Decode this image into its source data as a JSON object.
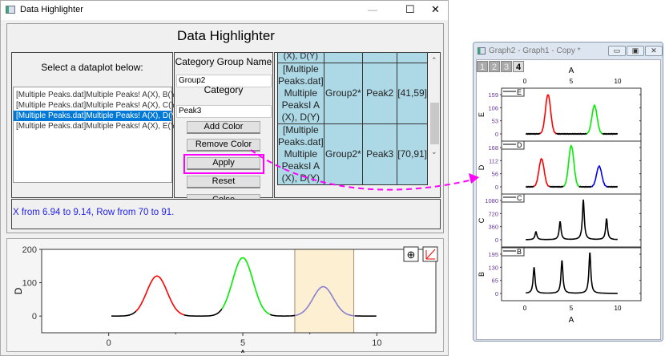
{
  "window": {
    "title": "Data Highlighter",
    "minimize": "—",
    "maximize": "☐",
    "close": "✕"
  },
  "dialog": {
    "heading": "Data Highlighter",
    "left": {
      "prompt": "Select a dataplot below:",
      "items": [
        {
          "label": "[Multiple Peaks.dat]Multiple Peaks! A(X), B(Y)",
          "selected": false
        },
        {
          "label": "[Multiple Peaks.dat]Multiple Peaks! A(X), C(Y)",
          "selected": false
        },
        {
          "label": "[Multiple Peaks.dat]Multiple Peaks! A(X), D(Y)",
          "selected": true
        },
        {
          "label": "[Multiple Peaks.dat]Multiple Peaks! A(X), E(Y)",
          "selected": false
        }
      ]
    },
    "middle": {
      "group_label": "Category Group Name",
      "group_value": "Group2",
      "category_label": "Category",
      "category_value": "Peak3",
      "buttons": {
        "add": "Add Color",
        "remove": "Remove Color",
        "apply": "Apply",
        "reset": "Reset",
        "close": "Colse"
      }
    },
    "table": {
      "partial_row": "(X), D(Y)",
      "rows": [
        {
          "plot": "[Multiple Peaks.dat] Multiple PeaksI A (X), D(Y)",
          "group": "Group2*",
          "category": "Peak2",
          "range": "[41,59]"
        },
        {
          "plot": "[Multiple Peaks.dat] Multiple PeaksI A (X), D(Y)",
          "group": "Group2*",
          "category": "Peak3",
          "range": "[70,91]"
        }
      ]
    },
    "status": "X from 6.94 to 9.14, Row from 70 to 91.",
    "highlight_color": "#ff00ff"
  },
  "chart_data": [
    {
      "type": "line",
      "id": "main",
      "xlabel": "A",
      "ylabel": "D",
      "xlim": [
        -2.5,
        12.2
      ],
      "ylim": [
        -50,
        200
      ],
      "xticks": [
        "0",
        "5",
        "10"
      ],
      "yticks": [
        "0",
        "100",
        "200"
      ],
      "highlight": {
        "x_from": 6.94,
        "x_to": 9.14,
        "color": "#fdf0d2"
      },
      "x_range": [
        0.1,
        10
      ],
      "peaks": [
        {
          "center": 1.8,
          "height": 120,
          "shape": "gaussian",
          "color": "#ff0000",
          "from": 1.0,
          "to": 2.8
        },
        {
          "center": 5.0,
          "height": 175,
          "shape": "gaussian",
          "color": "#00ee00",
          "from": 4.2,
          "to": 6.0
        },
        {
          "center": 8.0,
          "height": 88,
          "shape": "gaussian",
          "color": "#8a80d0",
          "from": 6.94,
          "to": 9.14
        }
      ],
      "tools": [
        "zoom-icon",
        "rescale-icon"
      ]
    },
    {
      "type": "line",
      "id": "graph2",
      "window_title": "Graph2 - Graph1 - Copy *",
      "tabs": [
        "1",
        "2",
        "3",
        "4"
      ],
      "active_tab": "4",
      "xlabel": "A",
      "xticks": [
        "0",
        "5",
        "10"
      ],
      "xlim": [
        -2.5,
        12.5
      ],
      "panels": [
        {
          "legend": "E",
          "ylabel": "E",
          "yticks": [
            "0",
            "53",
            "106",
            "159"
          ],
          "ymax": 159,
          "peaks": [
            {
              "center": 2.5,
              "height": 159,
              "shape": "gaussian",
              "color": "#ff0000"
            },
            {
              "center": 7.5,
              "height": 115,
              "shape": "gaussian",
              "color": "#00ee00"
            }
          ]
        },
        {
          "legend": "D",
          "ylabel": "D",
          "yticks": [
            "0",
            "56",
            "112",
            "168"
          ],
          "ymax": 168,
          "peaks": [
            {
              "center": 1.8,
              "height": 120,
              "shape": "gaussian",
              "color": "#ff0000"
            },
            {
              "center": 5.0,
              "height": 175,
              "shape": "gaussian",
              "color": "#00ee00"
            },
            {
              "center": 8.0,
              "height": 88,
              "shape": "gaussian",
              "color": "#0000ff"
            }
          ]
        },
        {
          "legend": "C",
          "ylabel": "C",
          "yticks": [
            "0",
            "360",
            "720",
            "1080"
          ],
          "ymax": 1080,
          "peaks": [
            {
              "center": 1.2,
              "height": 220,
              "shape": "lorentzian",
              "color": "#000000"
            },
            {
              "center": 3.8,
              "height": 500,
              "shape": "lorentzian",
              "color": "#000000"
            },
            {
              "center": 6.3,
              "height": 1100,
              "shape": "lorentzian",
              "color": "#000000"
            },
            {
              "center": 8.8,
              "height": 580,
              "shape": "lorentzian",
              "color": "#000000"
            }
          ]
        },
        {
          "legend": "B",
          "ylabel": "B",
          "yticks": [
            "0",
            "65",
            "130",
            "195"
          ],
          "ymax": 195,
          "peaks": [
            {
              "center": 1.0,
              "height": 130,
              "shape": "lorentzian",
              "color": "#000000"
            },
            {
              "center": 4.0,
              "height": 165,
              "shape": "lorentzian",
              "color": "#000000"
            },
            {
              "center": 7.0,
              "height": 205,
              "shape": "lorentzian",
              "color": "#000000"
            }
          ]
        }
      ]
    }
  ]
}
